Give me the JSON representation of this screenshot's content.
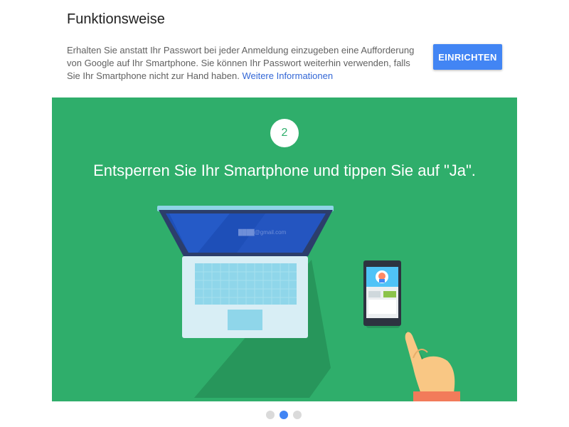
{
  "section": {
    "title": "Funktionsweise",
    "description": "Erhalten Sie anstatt Ihr Passwort bei jeder Anmeldung einzugeben eine Aufforderung von Google auf Ihr Smartphone. Sie können Ihr Passwort weiterhin verwenden, falls Sie Ihr Smartphone nicht zur Hand haben. ",
    "more_info_link": "Weitere Informationen",
    "setup_button": "EINRICHTEN"
  },
  "slide": {
    "step_number": "2",
    "heading": "Entsperren Sie Ihr Smartphone und tippen Sie auf \"Ja\".",
    "screen_email": "████@gmail.com",
    "background_color": "#2fae6b"
  },
  "carousel": {
    "dots": [
      "slide-1",
      "slide-2",
      "slide-3"
    ],
    "active_index": 1
  },
  "colors": {
    "accent": "#4285f4",
    "link": "#3367d6",
    "slide_green": "#2fae6b"
  }
}
